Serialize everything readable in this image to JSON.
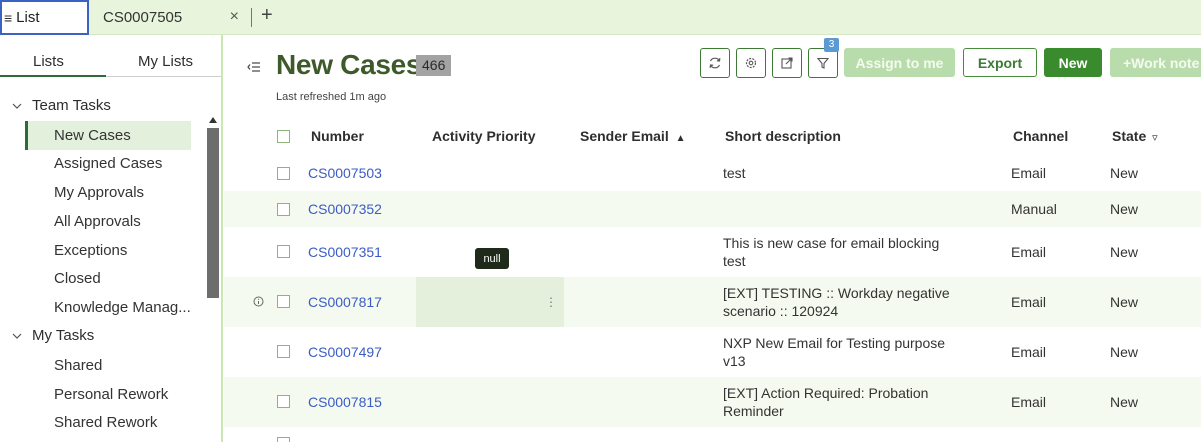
{
  "tabs": [
    {
      "label": "List",
      "icon": "hamburger-icon"
    },
    {
      "label": "CS0007505",
      "close_icon": "close-icon"
    }
  ],
  "add_tab_label": "+",
  "left_panel": {
    "tabs": [
      "Lists",
      "My Lists"
    ],
    "groups": [
      {
        "label": "Team Tasks",
        "items": [
          "New Cases",
          "Assigned Cases",
          "My Approvals",
          "All Approvals",
          "Exceptions",
          "Closed",
          "Knowledge Manag..."
        ]
      },
      {
        "label": "My Tasks",
        "items": [
          "Shared",
          "Personal Rework",
          "Shared Rework"
        ]
      }
    ],
    "active_item": "New Cases"
  },
  "header": {
    "title": "New Cases",
    "count": "466",
    "last_refreshed": "Last refreshed 1m ago",
    "filter_badge": "3",
    "buttons": {
      "assign": "Assign to me",
      "export": "Export",
      "new": "New",
      "work_note": "+Work note"
    }
  },
  "table": {
    "columns": [
      "Number",
      "Activity Priority",
      "Sender Email",
      "Short description",
      "Channel",
      "State"
    ],
    "sort_indicator": "▲",
    "filter_indicator": "▿",
    "rows": [
      {
        "number": "CS0007503",
        "priority": "",
        "sender": "",
        "desc": [
          "test"
        ],
        "channel": "Email",
        "state": "New"
      },
      {
        "number": "CS0007352",
        "priority": "",
        "sender": "",
        "desc": [
          ""
        ],
        "channel": "Manual",
        "state": "New"
      },
      {
        "number": "CS0007351",
        "priority": "",
        "sender": "",
        "desc": [
          "This is new case for email blocking",
          "test"
        ],
        "channel": "Email",
        "state": "New"
      },
      {
        "number": "CS0007817",
        "priority": "",
        "sender": "",
        "desc": [
          "[EXT] TESTING :: Workday negative",
          "scenario :: 120924"
        ],
        "channel": "Email",
        "state": "New"
      },
      {
        "number": "CS0007497",
        "priority": "",
        "sender": "",
        "desc": [
          "NXP New Email for Testing purpose",
          "v13"
        ],
        "channel": "Email",
        "state": "New"
      },
      {
        "number": "CS0007815",
        "priority": "",
        "sender": "",
        "desc": [
          "[EXT] Action Required: Probation",
          "Reminder"
        ],
        "channel": "Email",
        "state": "New"
      }
    ],
    "tooltip": "null"
  },
  "colors": {
    "brand_green": "#3d5a2a",
    "primary_button": "#3a8a2e",
    "tab_bar": "#e8f5dc",
    "link": "#3b5cc4"
  }
}
